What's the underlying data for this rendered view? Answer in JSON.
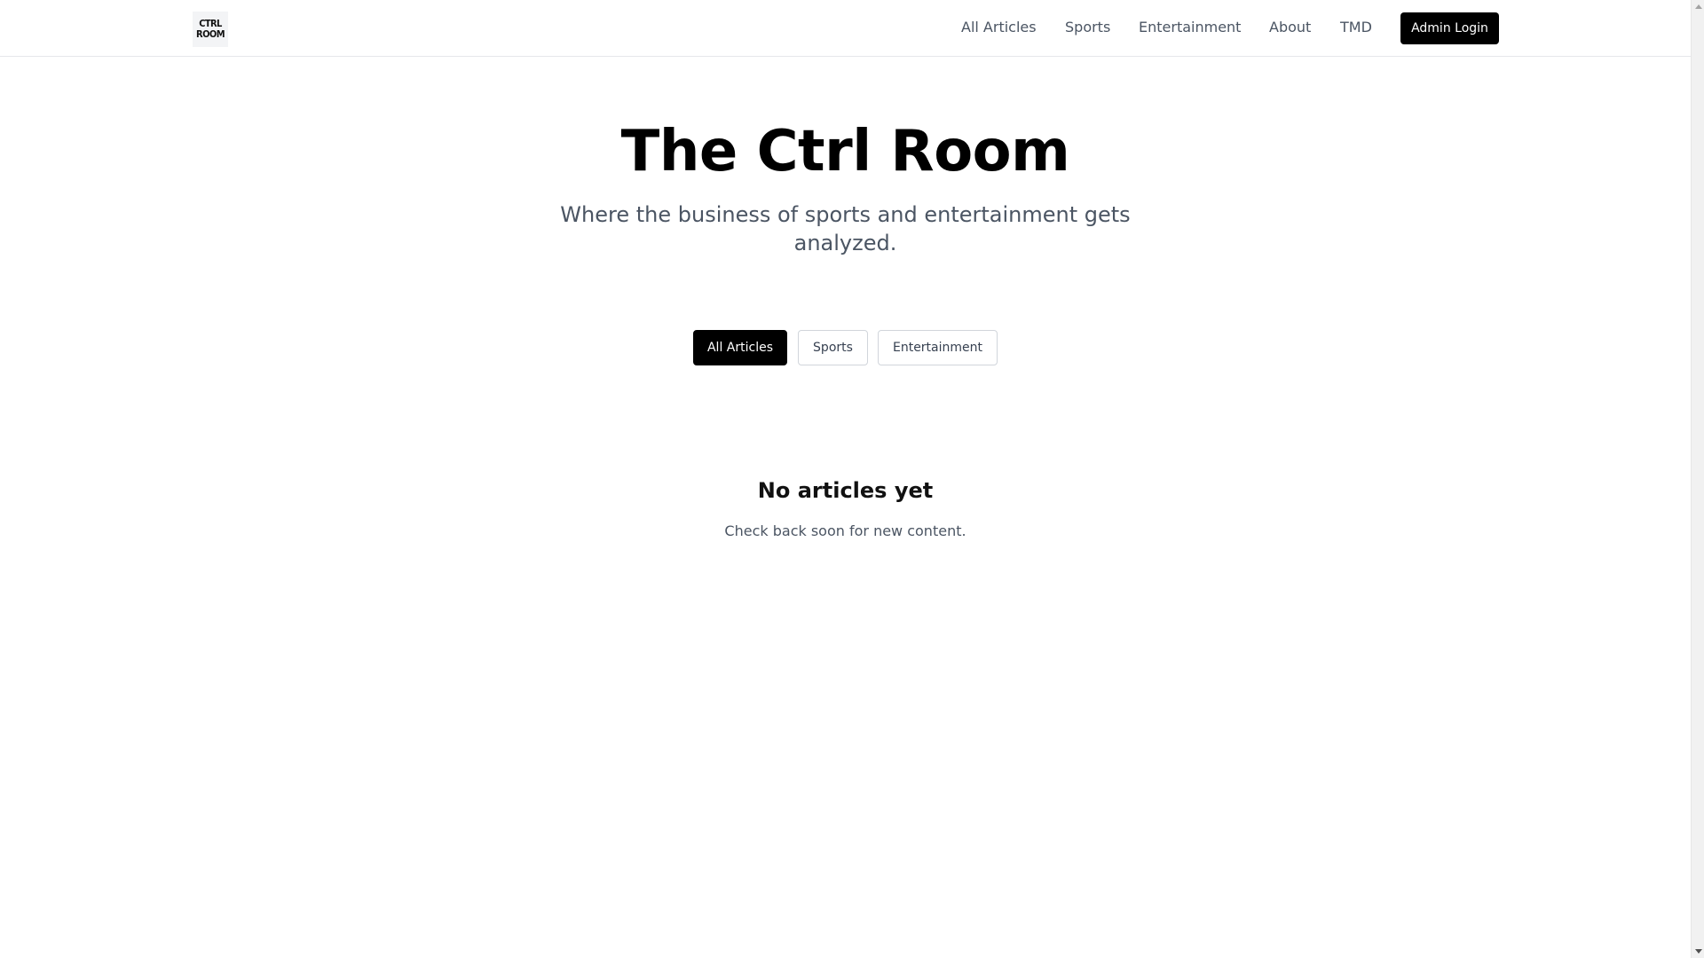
{
  "header": {
    "logo_line1": "CTRL",
    "logo_line2": "ROOM",
    "nav": [
      {
        "label": "All Articles"
      },
      {
        "label": "Sports"
      },
      {
        "label": "Entertainment"
      },
      {
        "label": "About"
      },
      {
        "label": "TMD"
      }
    ],
    "admin_label": "Admin Login"
  },
  "hero": {
    "title": "The Ctrl Room",
    "subtitle": "Where the business of sports and entertainment gets analyzed."
  },
  "filters": {
    "items": [
      {
        "label": "All Articles",
        "active": true
      },
      {
        "label": "Sports",
        "active": false
      },
      {
        "label": "Entertainment",
        "active": false
      }
    ]
  },
  "empty_state": {
    "title": "No articles yet",
    "text": "Check back soon for new content."
  },
  "colors": {
    "primary": "#000000",
    "muted_text": "#4b5563",
    "border": "#e5e7eb"
  }
}
